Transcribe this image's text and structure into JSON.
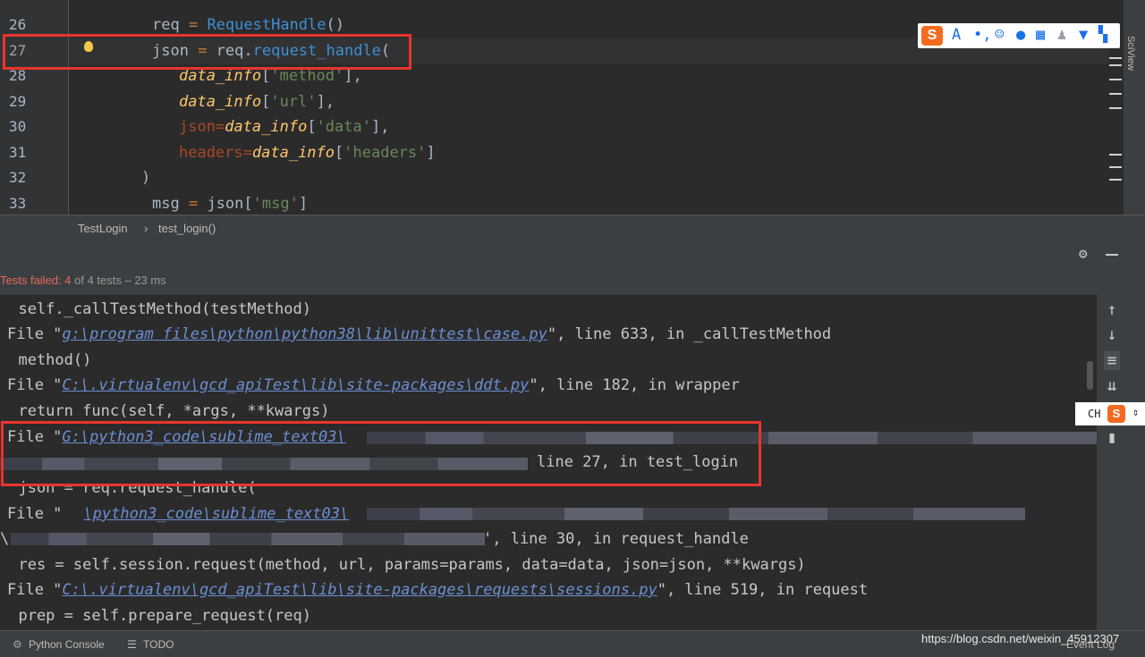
{
  "editor": {
    "line_numbers": [
      "26",
      "27",
      "28",
      "29",
      "30",
      "31",
      "32",
      "33"
    ],
    "lines": {
      "l26": {
        "var": "req",
        "op": " = ",
        "call": "RequestHandle",
        "tail": "()"
      },
      "l27": {
        "var": "json",
        "op": " = ",
        "obj": "req.",
        "call": "request_handle",
        "tail": "("
      },
      "l28": {
        "arg": "data_info",
        "key": "'method'",
        "tail": "],"
      },
      "l29": {
        "arg": "data_info",
        "key": "'url'",
        "tail": "],"
      },
      "l30": {
        "kw": "json=",
        "arg": "data_info",
        "key": "'data'",
        "tail": "],"
      },
      "l31": {
        "kw": "headers=",
        "arg": "data_info",
        "key": "'headers'",
        "tail": "]"
      },
      "l32": {
        "text": ")"
      },
      "l33": {
        "var": "msg",
        "op": " = ",
        "obj": "json[",
        "key": "'msg'",
        "tail": "]"
      }
    }
  },
  "breadcrumb": {
    "class_name": "TestLogin",
    "sep": "›",
    "method": "test_login()"
  },
  "run": {
    "failed_label": "Tests failed: 4",
    "rest": " of 4 tests – 23 ms"
  },
  "console": {
    "c1": "  self._callTestMethod(testMethod)",
    "c2_pre": "File \"",
    "c2_path": "g:\\program files\\python\\python38\\lib\\unittest\\case.py",
    "c2_post": "\", line 633, in _callTestMethod",
    "c3": "  method()",
    "c4_pre": "File \"",
    "c4_path": "C:\\.virtualenv\\gcd_apiTest\\lib\\site-packages\\ddt.py",
    "c4_post": "\", line 182, in wrapper",
    "c5": "  return func(self, *args, **kwargs)",
    "c6_pre": "File \"",
    "c6_path": "G:\\python3_code\\sublime_text03\\",
    "c7_post": "line 27, in test_login",
    "c8": "  json = req.request_handle(",
    "c9_pre": "File \"",
    "c9_path": "\\python3_code\\sublime_text03\\",
    "c10_pre": "\\",
    "c10_post": "', line 30, in request_handle",
    "c11": "  res = self.session.request(method, url, params=params, data=data, json=json, **kwargs)",
    "c12_pre": "File \"",
    "c12_path": "C:\\.virtualenv\\gcd_apiTest\\lib\\site-packages\\requests\\sessions.py",
    "c12_post": "\", line 519, in request",
    "c13": "  prep = self.prepare_request(req)"
  },
  "bottombar": {
    "python_console": "Python Console",
    "todo": "TODO",
    "event_log": "Event Log"
  },
  "sidebar_right": {
    "label": "SciView"
  },
  "ime": {
    "ch_label": "CH"
  },
  "watermark": "https://blog.csdn.net/weixin_45912307",
  "colors": {
    "red_box": "#e8352e",
    "failed": "#e46a5a",
    "link": "#6b8fd3"
  }
}
